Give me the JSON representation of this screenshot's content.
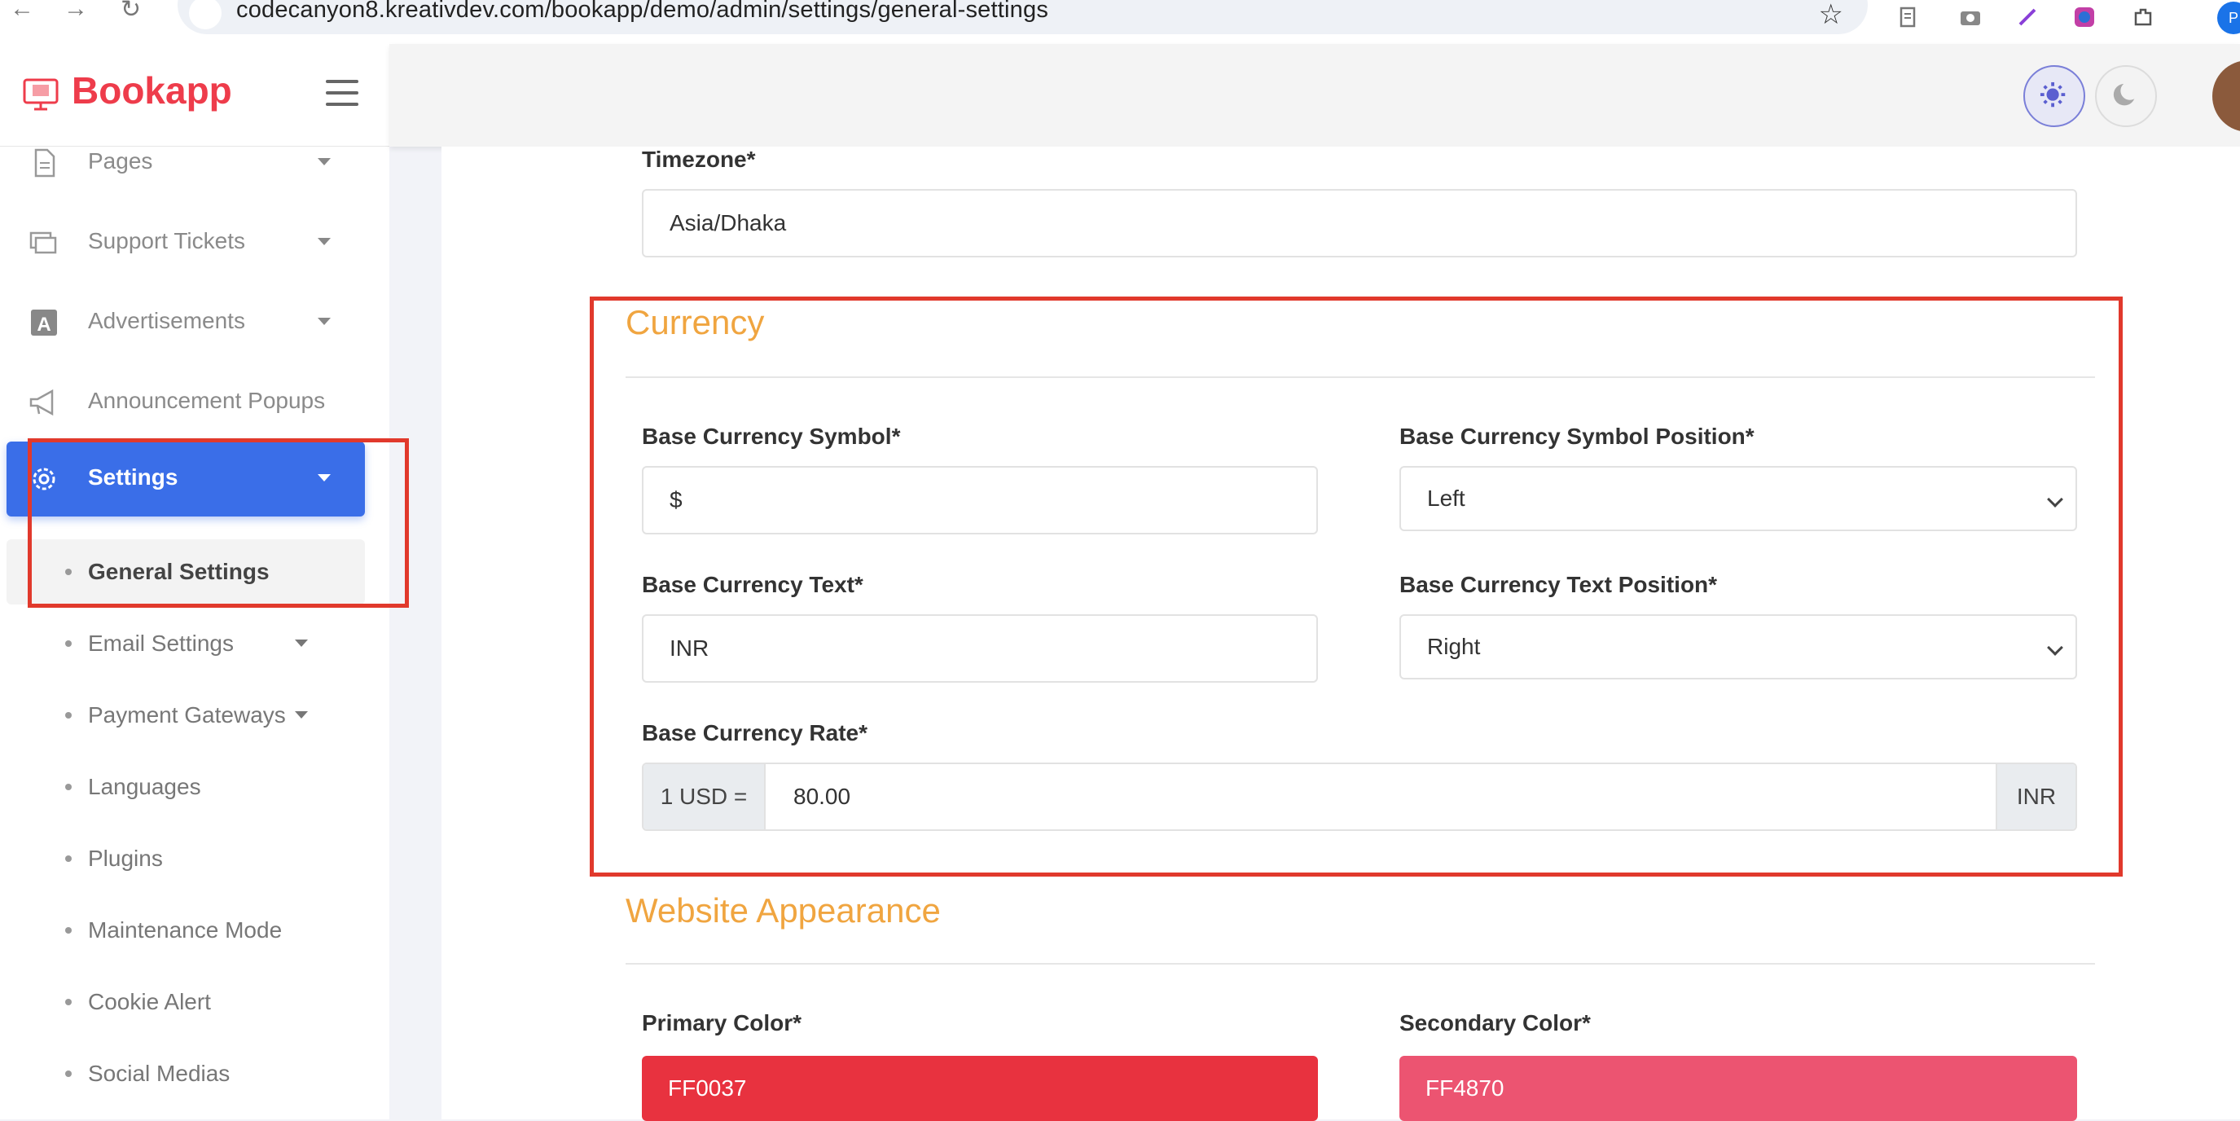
{
  "browser": {
    "url": "codecanyon8.kreativdev.com/bookapp/demo/admin/settings/general-settings",
    "profile_initial": "P"
  },
  "sidebar": {
    "brand": "Bookapp",
    "menu": [
      {
        "label": "Pages",
        "icon": "page-icon",
        "has_caret": true
      },
      {
        "label": "Support Tickets",
        "icon": "tickets-icon",
        "has_caret": true
      },
      {
        "label": "Advertisements",
        "icon": "ad-icon",
        "has_caret": true
      },
      {
        "label": "Announcement Popups",
        "icon": "megaphone-icon",
        "has_caret": false
      },
      {
        "label": "Settings",
        "icon": "gear-icon",
        "has_caret": true,
        "active": true
      }
    ],
    "submenu": [
      {
        "label": "General Settings",
        "current": true,
        "has_caret": false
      },
      {
        "label": "Email Settings",
        "has_caret": true
      },
      {
        "label": "Payment Gateways",
        "has_caret": true
      },
      {
        "label": "Languages",
        "has_caret": false
      },
      {
        "label": "Plugins",
        "has_caret": false
      },
      {
        "label": "Maintenance Mode",
        "has_caret": false
      },
      {
        "label": "Cookie Alert",
        "has_caret": false
      },
      {
        "label": "Social Medias",
        "has_caret": false
      }
    ]
  },
  "header": {
    "theme_light_icon": "sun-icon",
    "theme_dark_icon": "moon-icon"
  },
  "form": {
    "timezone": {
      "label": "Timezone*",
      "value": "Asia/Dhaka"
    },
    "currency": {
      "title": "Currency",
      "symbol": {
        "label": "Base Currency Symbol*",
        "value": "$"
      },
      "symbol_position": {
        "label": "Base Currency Symbol Position*",
        "value": "Left"
      },
      "text": {
        "label": "Base Currency Text*",
        "value": "INR"
      },
      "text_position": {
        "label": "Base Currency Text Position*",
        "value": "Right"
      },
      "rate": {
        "label": "Base Currency Rate*",
        "prefix": "1 USD =",
        "value": "80.00",
        "suffix": "INR"
      }
    },
    "appearance": {
      "title": "Website Appearance",
      "primary": {
        "label": "Primary Color*",
        "value": "FF0037",
        "color": "#e8323f"
      },
      "secondary": {
        "label": "Secondary Color*",
        "value": "FF4870",
        "color": "#ec5471"
      }
    }
  },
  "colors": {
    "accent": "#3a6ee8",
    "brand": "#ee3c4b",
    "section_title": "#f0a540",
    "annotation": "#e1392c"
  }
}
